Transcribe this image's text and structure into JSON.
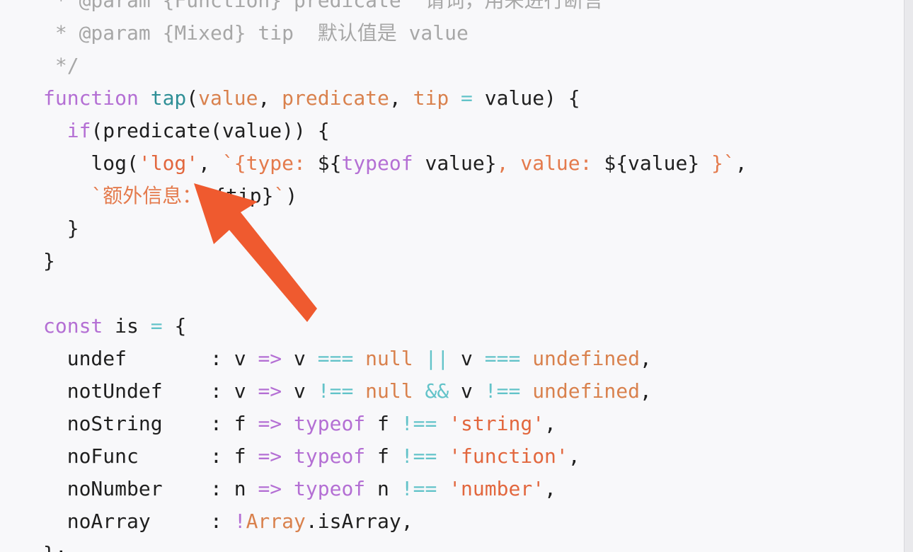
{
  "code_lines": [
    [
      {
        "t": " * @param {Function} predicate  请词，用来进行断言",
        "c": "comment"
      }
    ],
    [
      {
        "t": " * @param {Mixed} tip  默认值是 value",
        "c": "comment"
      }
    ],
    [
      {
        "t": " */",
        "c": "comment"
      }
    ],
    [
      {
        "t": "function",
        "c": "kw"
      },
      {
        "t": " ",
        "c": "id"
      },
      {
        "t": "tap",
        "c": "fn"
      },
      {
        "t": "(",
        "c": "id"
      },
      {
        "t": "value",
        "c": "param"
      },
      {
        "t": ", ",
        "c": "id"
      },
      {
        "t": "predicate",
        "c": "param"
      },
      {
        "t": ", ",
        "c": "id"
      },
      {
        "t": "tip",
        "c": "param"
      },
      {
        "t": " ",
        "c": "id"
      },
      {
        "t": "=",
        "c": "op"
      },
      {
        "t": " value) {",
        "c": "id"
      }
    ],
    [
      {
        "t": "  ",
        "c": "id"
      },
      {
        "t": "if",
        "c": "kw"
      },
      {
        "t": "(predicate(value)) {",
        "c": "id"
      }
    ],
    [
      {
        "t": "    log(",
        "c": "id"
      },
      {
        "t": "'log'",
        "c": "str"
      },
      {
        "t": ", ",
        "c": "id"
      },
      {
        "t": "`{type: ",
        "c": "tmpl"
      },
      {
        "t": "${",
        "c": "id"
      },
      {
        "t": "typeof",
        "c": "kw"
      },
      {
        "t": " value}",
        "c": "id"
      },
      {
        "t": ", value: ",
        "c": "tmpl"
      },
      {
        "t": "${value}",
        "c": "id"
      },
      {
        "t": " }`",
        "c": "tmpl"
      },
      {
        "t": ",",
        "c": "id"
      }
    ],
    [
      {
        "t": "    ",
        "c": "id"
      },
      {
        "t": "`额外信息：",
        "c": "tmpl"
      },
      {
        "t": "${tip}",
        "c": "id"
      },
      {
        "t": "`",
        "c": "tmpl"
      },
      {
        "t": ")",
        "c": "id"
      }
    ],
    [
      {
        "t": "  }",
        "c": "id"
      }
    ],
    [
      {
        "t": "}",
        "c": "id"
      }
    ],
    [
      {
        "t": "",
        "c": "id"
      }
    ],
    [
      {
        "t": "const",
        "c": "kw"
      },
      {
        "t": " is ",
        "c": "id"
      },
      {
        "t": "=",
        "c": "op"
      },
      {
        "t": " {",
        "c": "id"
      }
    ],
    [
      {
        "t": "  undef       : v ",
        "c": "id"
      },
      {
        "t": "=>",
        "c": "kw"
      },
      {
        "t": " v ",
        "c": "id"
      },
      {
        "t": "===",
        "c": "op"
      },
      {
        "t": " ",
        "c": "id"
      },
      {
        "t": "null",
        "c": "num"
      },
      {
        "t": " ",
        "c": "id"
      },
      {
        "t": "||",
        "c": "op"
      },
      {
        "t": " v ",
        "c": "id"
      },
      {
        "t": "===",
        "c": "op"
      },
      {
        "t": " ",
        "c": "id"
      },
      {
        "t": "undefined",
        "c": "num"
      },
      {
        "t": ",",
        "c": "id"
      }
    ],
    [
      {
        "t": "  notUndef    : v ",
        "c": "id"
      },
      {
        "t": "=>",
        "c": "kw"
      },
      {
        "t": " v ",
        "c": "id"
      },
      {
        "t": "!==",
        "c": "op"
      },
      {
        "t": " ",
        "c": "id"
      },
      {
        "t": "null",
        "c": "num"
      },
      {
        "t": " ",
        "c": "id"
      },
      {
        "t": "&&",
        "c": "op"
      },
      {
        "t": " v ",
        "c": "id"
      },
      {
        "t": "!==",
        "c": "op"
      },
      {
        "t": " ",
        "c": "id"
      },
      {
        "t": "undefined",
        "c": "num"
      },
      {
        "t": ",",
        "c": "id"
      }
    ],
    [
      {
        "t": "  noString    : f ",
        "c": "id"
      },
      {
        "t": "=>",
        "c": "kw"
      },
      {
        "t": " ",
        "c": "id"
      },
      {
        "t": "typeof",
        "c": "kw"
      },
      {
        "t": " f ",
        "c": "id"
      },
      {
        "t": "!==",
        "c": "op"
      },
      {
        "t": " ",
        "c": "id"
      },
      {
        "t": "'string'",
        "c": "str"
      },
      {
        "t": ",",
        "c": "id"
      }
    ],
    [
      {
        "t": "  noFunc      : f ",
        "c": "id"
      },
      {
        "t": "=>",
        "c": "kw"
      },
      {
        "t": " ",
        "c": "id"
      },
      {
        "t": "typeof",
        "c": "kw"
      },
      {
        "t": " f ",
        "c": "id"
      },
      {
        "t": "!==",
        "c": "op"
      },
      {
        "t": " ",
        "c": "id"
      },
      {
        "t": "'function'",
        "c": "str"
      },
      {
        "t": ",",
        "c": "id"
      }
    ],
    [
      {
        "t": "  noNumber    : n ",
        "c": "id"
      },
      {
        "t": "=>",
        "c": "kw"
      },
      {
        "t": " ",
        "c": "id"
      },
      {
        "t": "typeof",
        "c": "kw"
      },
      {
        "t": " n ",
        "c": "id"
      },
      {
        "t": "!==",
        "c": "op"
      },
      {
        "t": " ",
        "c": "id"
      },
      {
        "t": "'number'",
        "c": "str"
      },
      {
        "t": ",",
        "c": "id"
      }
    ],
    [
      {
        "t": "  noArray     : ",
        "c": "id"
      },
      {
        "t": "!",
        "c": "kw"
      },
      {
        "t": "Array",
        "c": "param"
      },
      {
        "t": ".isArray,",
        "c": "id"
      }
    ],
    [
      {
        "t": "};",
        "c": "id"
      }
    ]
  ],
  "colors": {
    "background": "#f8f8fa",
    "comment": "#a7a7a7",
    "keyword": "#b46fd4",
    "function": "#2f8f96",
    "param": "#d9814d",
    "operator": "#63c3c9",
    "string": "#e2673e",
    "annotation_arrow": "#ef5a2f"
  },
  "annotation": {
    "icon": "annotation-arrow-icon"
  }
}
